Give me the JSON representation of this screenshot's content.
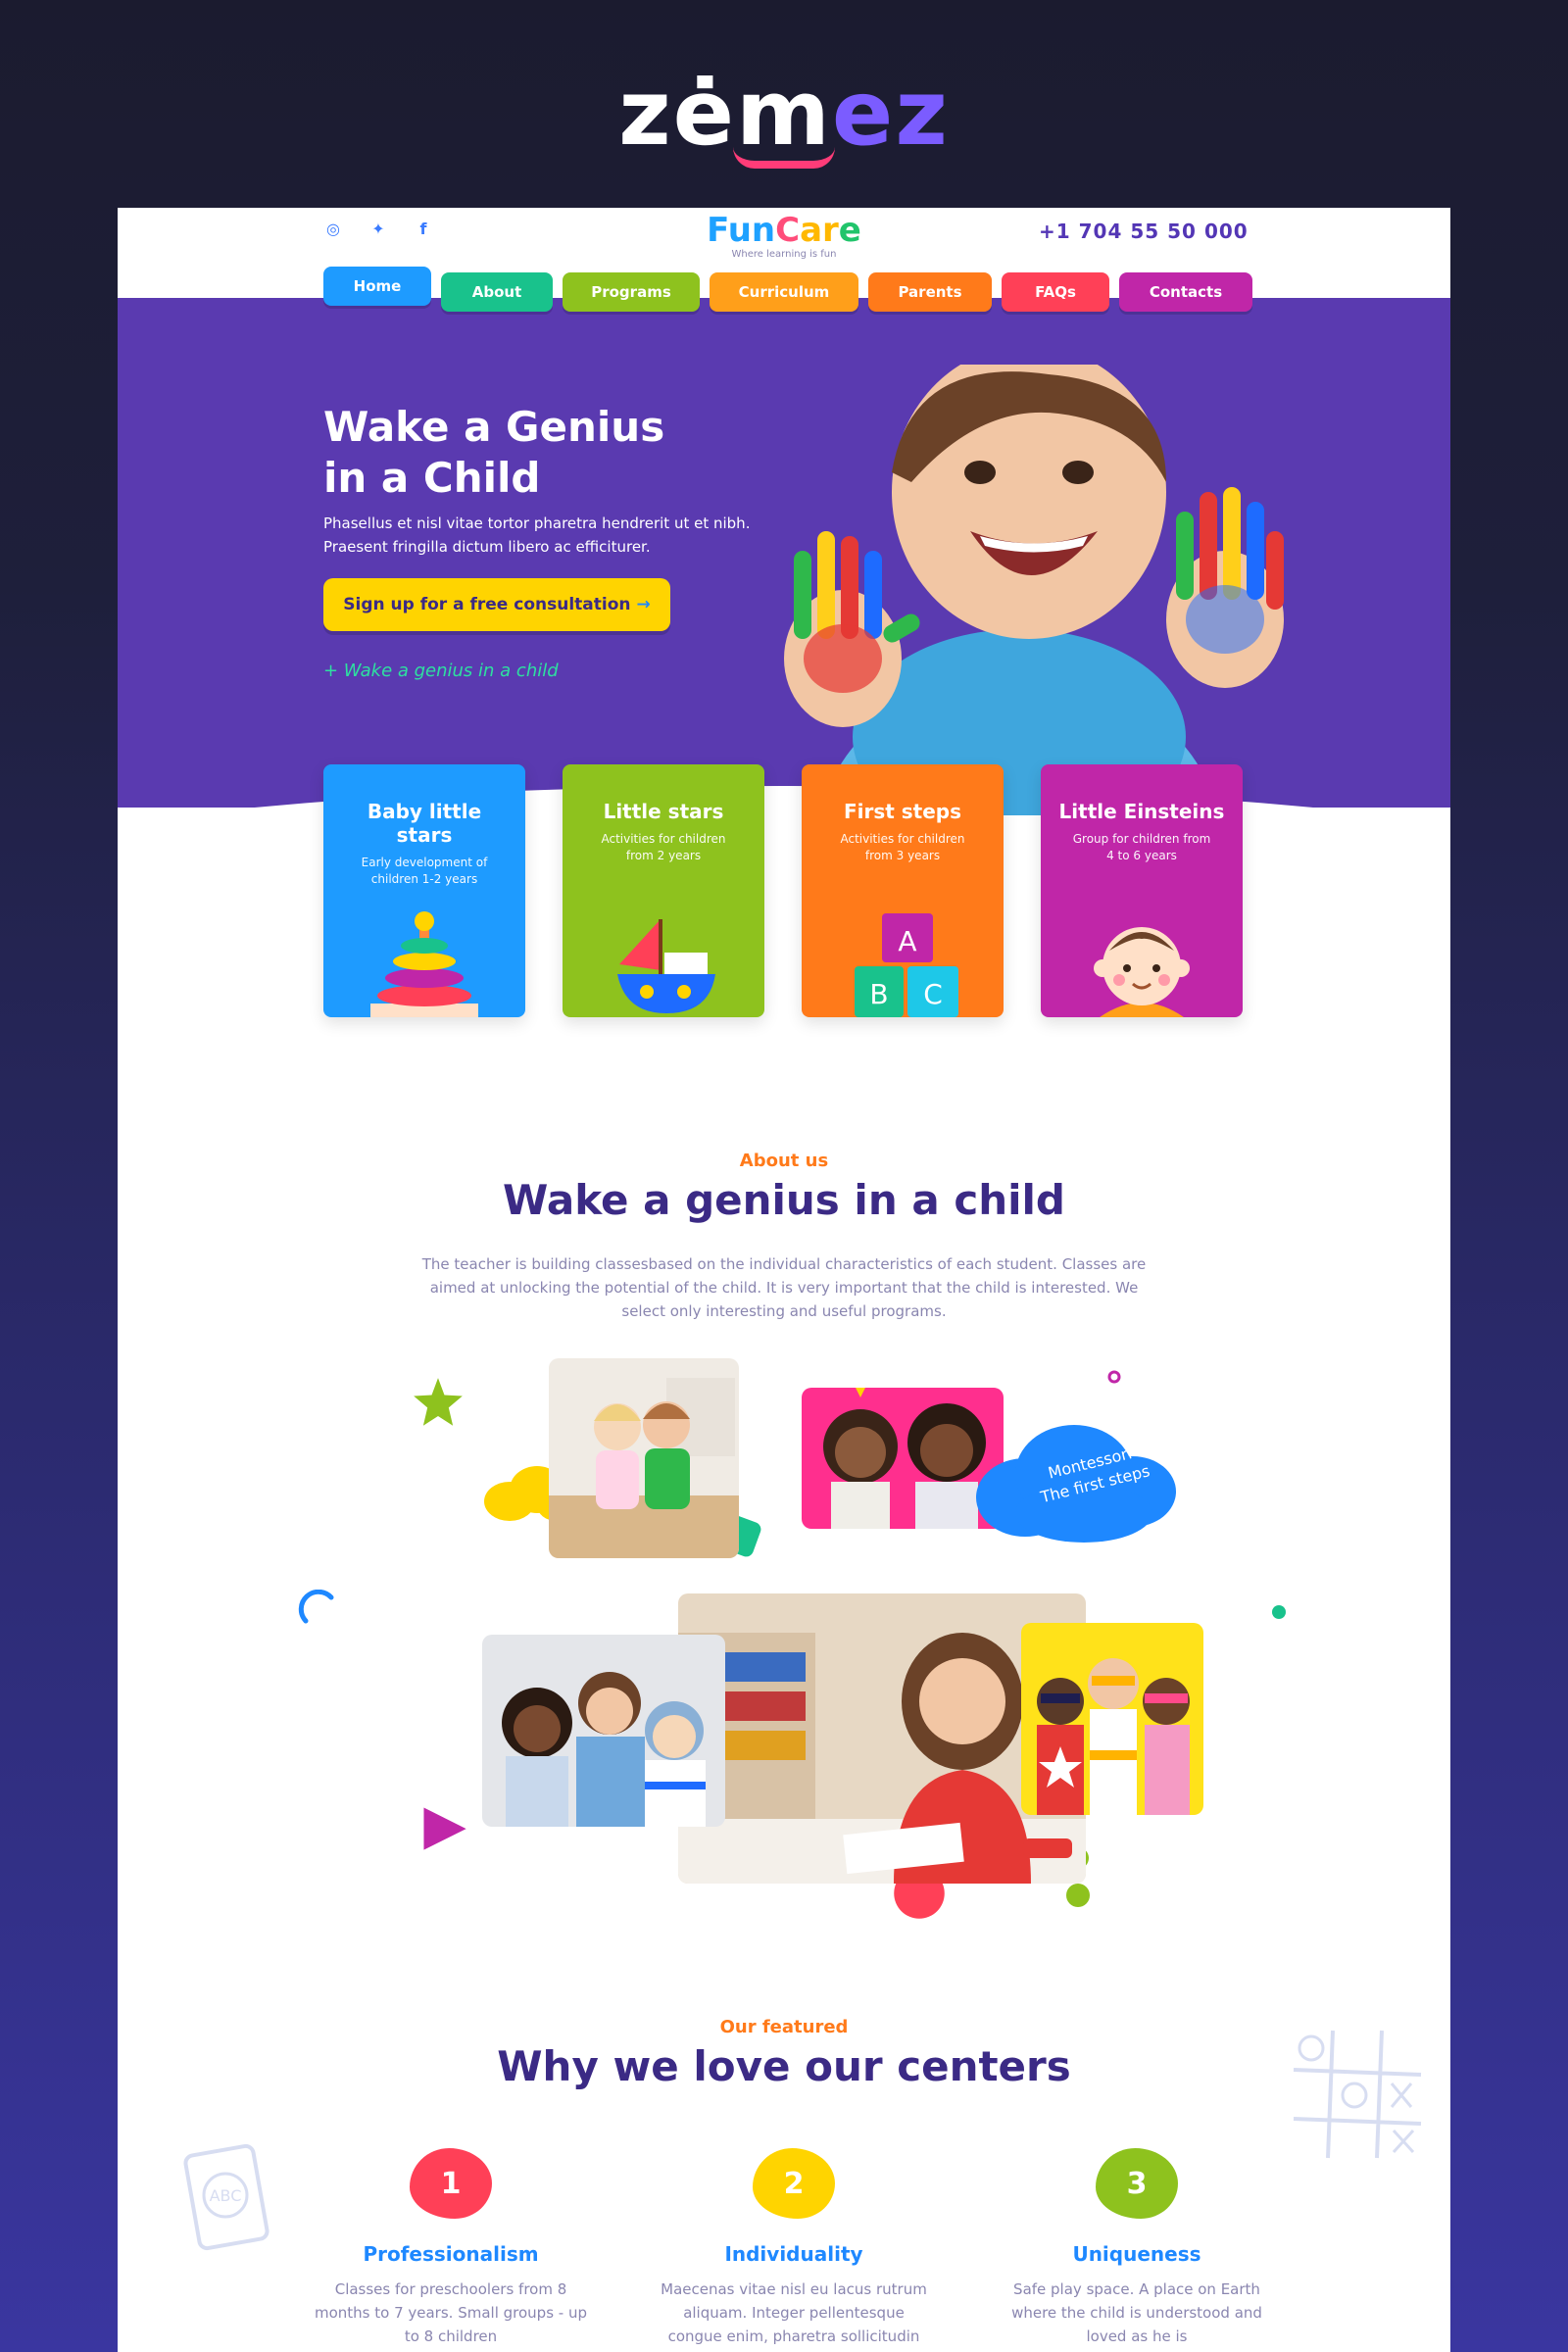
{
  "brand": {
    "logo_main": "zėm",
    "logo_accent": "ez"
  },
  "header": {
    "logo": {
      "part1": "Fun",
      "part2": "C",
      "part3": "ar",
      "part4": "e",
      "tagline": "Where learning is fun"
    },
    "phone": "+1 704 55 50 000",
    "socials": [
      {
        "icon": "instagram-icon",
        "glyph": "◎"
      },
      {
        "icon": "twitter-icon",
        "glyph": "✦"
      },
      {
        "icon": "facebook-icon",
        "glyph": "f"
      }
    ]
  },
  "nav": {
    "items": [
      {
        "label": "Home",
        "color": "#1e9bff"
      },
      {
        "label": "About",
        "color": "#19c28c"
      },
      {
        "label": "Programs",
        "color": "#8ec21e"
      },
      {
        "label": "Curriculum",
        "color": "#ff9f1a"
      },
      {
        "label": "Parents",
        "color": "#ff7a1a"
      },
      {
        "label": "FAQs",
        "color": "#ff4057"
      },
      {
        "label": "Contacts",
        "color": "#c026a8"
      }
    ]
  },
  "hero": {
    "title_line1": "Wake a Genius",
    "title_line2": "in a Child",
    "text": "Phasellus et nisl vitae tortor pharetra hendrerit ut et nibh. Praesent fringilla dictum libero ac efficiturer.",
    "cta": "Sign up for a free consultation",
    "cta_arrow": "→",
    "tagline": "+ Wake a genius in a child",
    "bg_color": "#5a3ab0",
    "cta_color": "#ffd400"
  },
  "cards": [
    {
      "title": "Baby little stars",
      "desc": "Early development of children 1-2 years",
      "color": "#1e9bff",
      "icon": "toy-pyramid-icon"
    },
    {
      "title": "Little stars",
      "desc": "Activities for children from 2 years",
      "color": "#8ec21e",
      "icon": "toy-boat-icon"
    },
    {
      "title": "First steps",
      "desc": "Activities for children from 3 years",
      "color": "#ff7a1a",
      "icon": "abc-blocks-icon"
    },
    {
      "title": "Little Einsteins",
      "desc": "Group for children from 4 to 6 years",
      "color": "#c026a8",
      "icon": "baby-face-icon"
    }
  ],
  "about": {
    "eyebrow": "About us",
    "title": "Wake a genius in a child",
    "text": "The teacher is building classesbased on the individual characteristics of each student. Classes are aimed at unlocking the potential of the child. It is very important that the child is interested. We select only interesting and useful programs.",
    "cloud_line1": "Montessori",
    "cloud_line2": "The first steps"
  },
  "featured": {
    "eyebrow": "Our featured",
    "title": "Why we love our centers",
    "items": [
      {
        "num": "1",
        "title": "Professionalism",
        "text": "Classes for preschoolers from 8 months to 7 years. Small groups - up to 8 children",
        "color": "#ff4057"
      },
      {
        "num": "2",
        "title": "Individuality",
        "text": "Maecenas vitae nisl eu lacus rutrum aliquam. Integer pellentesque congue enim, pharetra sollicitudin arcu",
        "color": "#ffd400"
      },
      {
        "num": "3",
        "title": "Uniqueness",
        "text": "Safe play space. A place on Earth where the child is understood and loved as he is",
        "color": "#8ec21e"
      }
    ]
  }
}
